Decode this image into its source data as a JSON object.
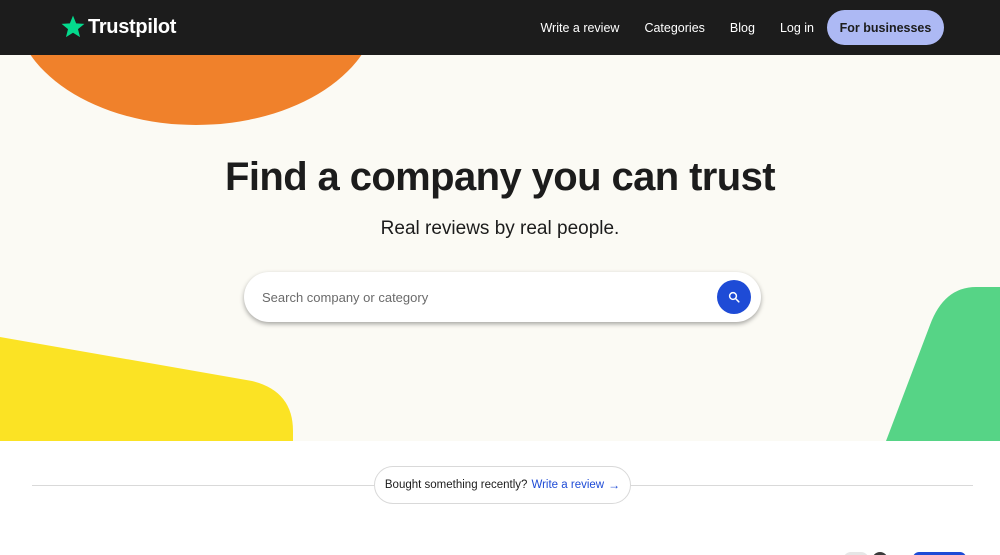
{
  "header": {
    "logo_text": "Trustpilot",
    "logo_icon": "star-icon",
    "nav": [
      {
        "label": "Write a review"
      },
      {
        "label": "Categories"
      },
      {
        "label": "Blog"
      },
      {
        "label": "Log in"
      }
    ],
    "business_button": "For businesses"
  },
  "hero": {
    "title": "Find a company you can trust",
    "subtitle": "Real reviews by real people.",
    "search": {
      "placeholder": "Search company or category",
      "value": "",
      "button_icon": "search-icon"
    }
  },
  "recent": {
    "text": "Bought something recently?",
    "link": "Write a review",
    "arrow_icon": "arrow-right-icon"
  },
  "colors": {
    "header_bg": "#1c1c1c",
    "brand_green": "#04da8d",
    "hero_bg": "#fbfaf4",
    "orange": "#f0812b",
    "yellow": "#fbe324",
    "green_shape": "#56d486",
    "accent_blue": "#1e4bd6",
    "business_button": "#adb9f4"
  }
}
